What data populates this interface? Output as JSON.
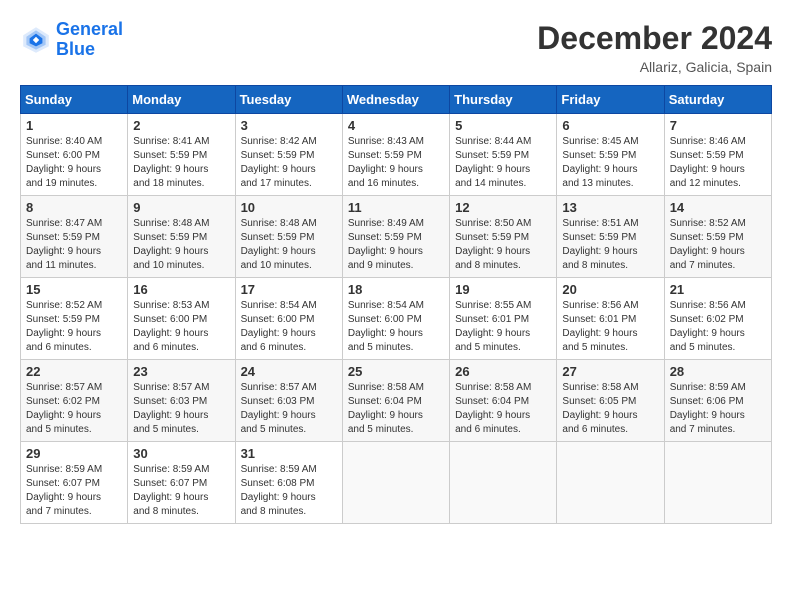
{
  "header": {
    "logo_line1": "General",
    "logo_line2": "Blue",
    "month": "December 2024",
    "location": "Allariz, Galicia, Spain"
  },
  "weekdays": [
    "Sunday",
    "Monday",
    "Tuesday",
    "Wednesday",
    "Thursday",
    "Friday",
    "Saturday"
  ],
  "weeks": [
    [
      {
        "day": "1",
        "info": "Sunrise: 8:40 AM\nSunset: 6:00 PM\nDaylight: 9 hours\nand 19 minutes."
      },
      {
        "day": "2",
        "info": "Sunrise: 8:41 AM\nSunset: 5:59 PM\nDaylight: 9 hours\nand 18 minutes."
      },
      {
        "day": "3",
        "info": "Sunrise: 8:42 AM\nSunset: 5:59 PM\nDaylight: 9 hours\nand 17 minutes."
      },
      {
        "day": "4",
        "info": "Sunrise: 8:43 AM\nSunset: 5:59 PM\nDaylight: 9 hours\nand 16 minutes."
      },
      {
        "day": "5",
        "info": "Sunrise: 8:44 AM\nSunset: 5:59 PM\nDaylight: 9 hours\nand 14 minutes."
      },
      {
        "day": "6",
        "info": "Sunrise: 8:45 AM\nSunset: 5:59 PM\nDaylight: 9 hours\nand 13 minutes."
      },
      {
        "day": "7",
        "info": "Sunrise: 8:46 AM\nSunset: 5:59 PM\nDaylight: 9 hours\nand 12 minutes."
      }
    ],
    [
      {
        "day": "8",
        "info": "Sunrise: 8:47 AM\nSunset: 5:59 PM\nDaylight: 9 hours\nand 11 minutes."
      },
      {
        "day": "9",
        "info": "Sunrise: 8:48 AM\nSunset: 5:59 PM\nDaylight: 9 hours\nand 10 minutes."
      },
      {
        "day": "10",
        "info": "Sunrise: 8:48 AM\nSunset: 5:59 PM\nDaylight: 9 hours\nand 10 minutes."
      },
      {
        "day": "11",
        "info": "Sunrise: 8:49 AM\nSunset: 5:59 PM\nDaylight: 9 hours\nand 9 minutes."
      },
      {
        "day": "12",
        "info": "Sunrise: 8:50 AM\nSunset: 5:59 PM\nDaylight: 9 hours\nand 8 minutes."
      },
      {
        "day": "13",
        "info": "Sunrise: 8:51 AM\nSunset: 5:59 PM\nDaylight: 9 hours\nand 8 minutes."
      },
      {
        "day": "14",
        "info": "Sunrise: 8:52 AM\nSunset: 5:59 PM\nDaylight: 9 hours\nand 7 minutes."
      }
    ],
    [
      {
        "day": "15",
        "info": "Sunrise: 8:52 AM\nSunset: 5:59 PM\nDaylight: 9 hours\nand 6 minutes."
      },
      {
        "day": "16",
        "info": "Sunrise: 8:53 AM\nSunset: 6:00 PM\nDaylight: 9 hours\nand 6 minutes."
      },
      {
        "day": "17",
        "info": "Sunrise: 8:54 AM\nSunset: 6:00 PM\nDaylight: 9 hours\nand 6 minutes."
      },
      {
        "day": "18",
        "info": "Sunrise: 8:54 AM\nSunset: 6:00 PM\nDaylight: 9 hours\nand 5 minutes."
      },
      {
        "day": "19",
        "info": "Sunrise: 8:55 AM\nSunset: 6:01 PM\nDaylight: 9 hours\nand 5 minutes."
      },
      {
        "day": "20",
        "info": "Sunrise: 8:56 AM\nSunset: 6:01 PM\nDaylight: 9 hours\nand 5 minutes."
      },
      {
        "day": "21",
        "info": "Sunrise: 8:56 AM\nSunset: 6:02 PM\nDaylight: 9 hours\nand 5 minutes."
      }
    ],
    [
      {
        "day": "22",
        "info": "Sunrise: 8:57 AM\nSunset: 6:02 PM\nDaylight: 9 hours\nand 5 minutes."
      },
      {
        "day": "23",
        "info": "Sunrise: 8:57 AM\nSunset: 6:03 PM\nDaylight: 9 hours\nand 5 minutes."
      },
      {
        "day": "24",
        "info": "Sunrise: 8:57 AM\nSunset: 6:03 PM\nDaylight: 9 hours\nand 5 minutes."
      },
      {
        "day": "25",
        "info": "Sunrise: 8:58 AM\nSunset: 6:04 PM\nDaylight: 9 hours\nand 5 minutes."
      },
      {
        "day": "26",
        "info": "Sunrise: 8:58 AM\nSunset: 6:04 PM\nDaylight: 9 hours\nand 6 minutes."
      },
      {
        "day": "27",
        "info": "Sunrise: 8:58 AM\nSunset: 6:05 PM\nDaylight: 9 hours\nand 6 minutes."
      },
      {
        "day": "28",
        "info": "Sunrise: 8:59 AM\nSunset: 6:06 PM\nDaylight: 9 hours\nand 7 minutes."
      }
    ],
    [
      {
        "day": "29",
        "info": "Sunrise: 8:59 AM\nSunset: 6:07 PM\nDaylight: 9 hours\nand 7 minutes."
      },
      {
        "day": "30",
        "info": "Sunrise: 8:59 AM\nSunset: 6:07 PM\nDaylight: 9 hours\nand 8 minutes."
      },
      {
        "day": "31",
        "info": "Sunrise: 8:59 AM\nSunset: 6:08 PM\nDaylight: 9 hours\nand 8 minutes."
      },
      null,
      null,
      null,
      null
    ]
  ]
}
